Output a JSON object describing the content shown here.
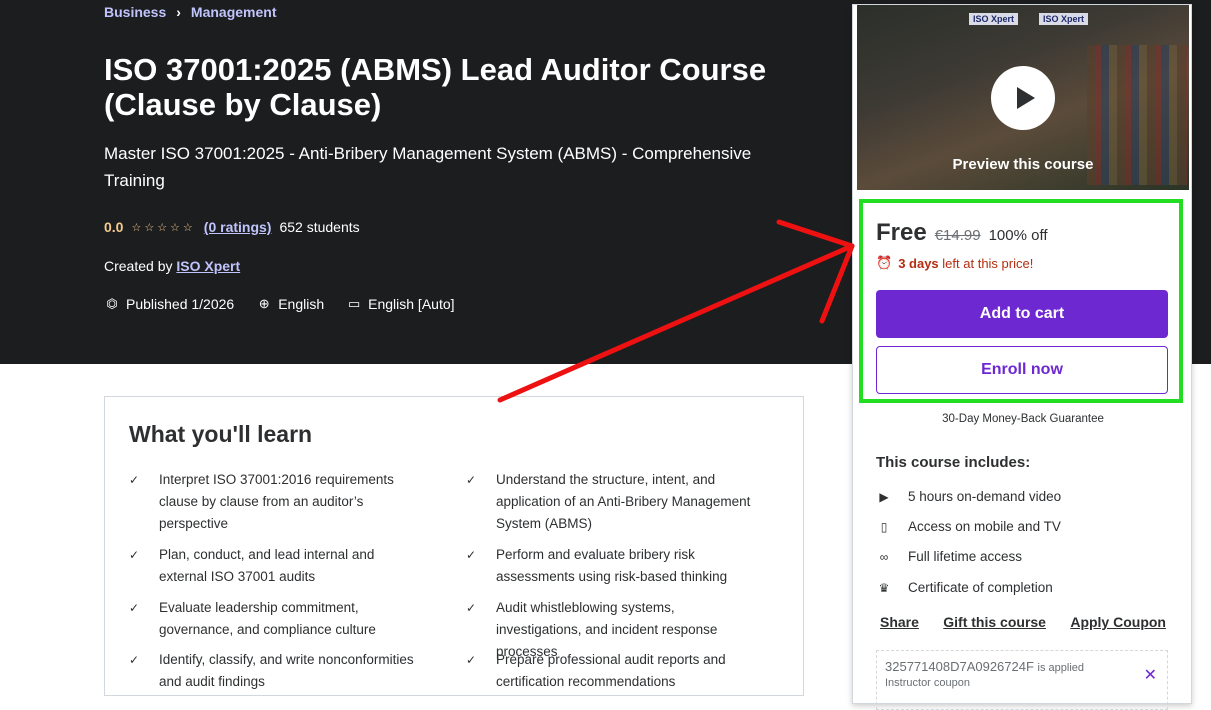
{
  "breadcrumb": {
    "items": [
      "Business",
      "Management"
    ]
  },
  "course": {
    "title": "ISO 37001:2025 (ABMS) Lead Auditor Course (Clause by Clause)",
    "subtitle": "Master ISO 37001:2025 - Anti-Bribery Management System (ABMS) - Comprehensive Training",
    "rating": "0.0",
    "stars": "☆☆☆☆☆",
    "ratings_count": "(0 ratings)",
    "students": "652 students",
    "created_by_label": "Created by",
    "instructor": "ISO Xpert",
    "published": "Published 1/2026",
    "language": "English",
    "captions": "English [Auto]"
  },
  "learn": {
    "heading": "What you'll learn",
    "items": [
      "Interpret ISO 37001:2016 requirements clause by clause from an auditor’s perspective",
      "Understand the structure, intent, and application of an Anti-Bribery Management System (ABMS)",
      "Plan, conduct, and lead internal and external ISO 37001 audits",
      "Perform and evaluate bribery risk assessments using risk-based thinking",
      "Evaluate leadership commitment, governance, and compliance culture",
      "Audit whistleblowing systems, investigations, and incident response processes",
      "Identify, classify, and write nonconformities and audit findings",
      "Prepare professional audit reports and certification recommendations"
    ]
  },
  "sidebar": {
    "preview_logo": "ISO Xpert",
    "preview_label": "Preview this course",
    "price": "Free",
    "original_price": "€14.99",
    "discount": "100% off",
    "timer_bold": "3 days",
    "timer_rest": "left at this price!",
    "add_to_cart": "Add to cart",
    "enroll_now": "Enroll now",
    "guarantee": "30-Day Money-Back Guarantee",
    "includes_title": "This course includes:",
    "includes": [
      {
        "icon": "video-icon",
        "text": "5 hours on-demand video"
      },
      {
        "icon": "mobile-icon",
        "text": "Access on mobile and TV"
      },
      {
        "icon": "infinity-icon",
        "text": "Full lifetime access"
      },
      {
        "icon": "trophy-icon",
        "text": "Certificate of completion"
      }
    ],
    "links": {
      "share": "Share",
      "gift": "Gift this course",
      "coupon": "Apply Coupon"
    },
    "coupon": {
      "code": "325771408D7A0926724F",
      "applied": "is applied",
      "sub": "Instructor coupon"
    }
  },
  "colors": {
    "hero_bg": "#1c1d1f",
    "accent_purple": "#6d28d2",
    "link_lavender": "#c0c4fc",
    "rating_gold": "#f3ca8c",
    "timer_red": "#b32d0f",
    "highlight_green": "#22dd22",
    "annotation_arrow": "#ee1111"
  }
}
